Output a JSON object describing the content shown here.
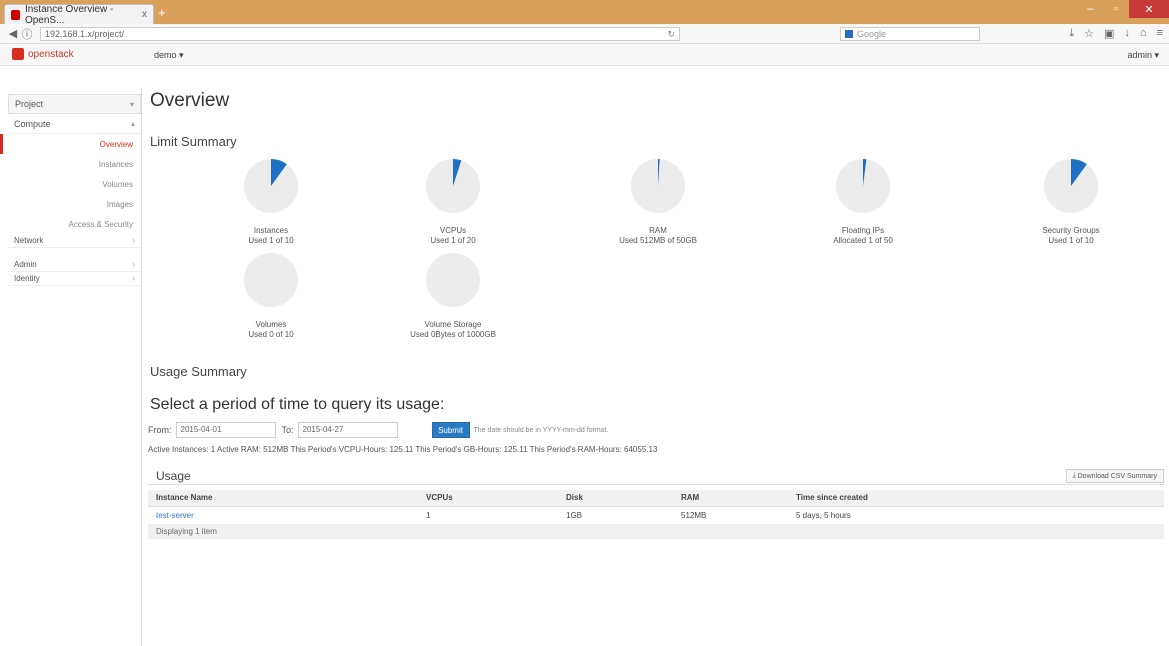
{
  "browser": {
    "tab_title": "Instance Overview - OpenS...",
    "tab_close": "x",
    "new_tab": "+",
    "url": "192.168.1.x/project/",
    "search_placeholder": "Google",
    "window_controls": [
      "–",
      "▫",
      "✕"
    ]
  },
  "app": {
    "logo_text": "openstack",
    "project_selector": "demo ▾",
    "user_menu": "admin ▾"
  },
  "sidebar": {
    "project_label": "Project",
    "compute_label": "Compute",
    "compute_links": [
      "Overview",
      "Instances",
      "Volumes",
      "Images",
      "Access & Security"
    ],
    "network_label": "Network",
    "admin_label": "Admin",
    "identity_label": "Identity"
  },
  "main": {
    "title": "Overview",
    "limit_summary_heading": "Limit Summary",
    "usage_summary_heading": "Usage Summary",
    "query_heading": "Select a period of time to query its usage:",
    "form": {
      "from_label": "From:",
      "from_value": "2015-04-01",
      "to_label": "To:",
      "to_value": "2015-04-27",
      "submit_label": "Submit",
      "hint": "The date should be in YYYY-mm-dd format."
    },
    "summary_line": "Active Instances: 1 Active RAM: 512MB This Period's VCPU-Hours: 125.11 This Period's GB-Hours: 125.11 This Period's RAM-Hours: 64055.13",
    "usage_caption": "Usage",
    "download_label": "Download CSV Summary",
    "table_headers": [
      "Instance Name",
      "VCPUs",
      "Disk",
      "RAM",
      "Time since created"
    ],
    "table_rows": [
      [
        "test-server",
        "1",
        "1GB",
        "512MB",
        "5 days, 5 hours"
      ]
    ],
    "table_footer": "Displaying 1 item"
  },
  "limits": [
    {
      "name": "Instances",
      "used_text": "Used 1 of 10",
      "fraction": 0.1
    },
    {
      "name": "VCPUs",
      "used_text": "Used 1 of 20",
      "fraction": 0.05
    },
    {
      "name": "RAM",
      "used_text": "Used 512MB of 50GB",
      "fraction": 0.01
    },
    {
      "name": "Floating IPs",
      "used_text": "Allocated 1 of 50",
      "fraction": 0.02
    },
    {
      "name": "Security Groups",
      "used_text": "Used 1 of 10",
      "fraction": 0.1
    },
    {
      "name": "Volumes",
      "used_text": "Used 0 of 10",
      "fraction": 0
    },
    {
      "name": "Volume Storage",
      "used_text": "Used 0Bytes of 1000GB",
      "fraction": 0
    }
  ],
  "colors": {
    "pie_used": "#1f6fc5",
    "pie_free": "#ececec",
    "accent": "#d62d20"
  }
}
